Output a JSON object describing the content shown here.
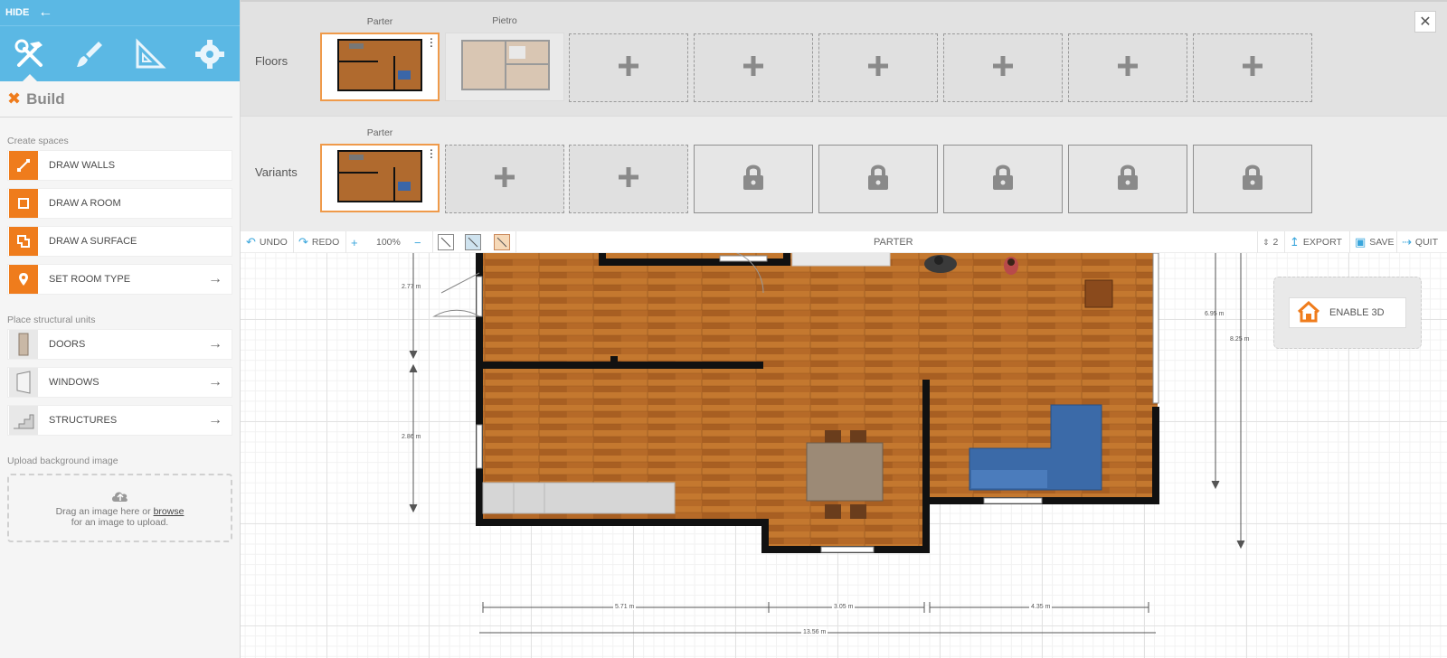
{
  "sidebar": {
    "hide_label": "HIDE",
    "panel_title": "Build",
    "create_label": "Create spaces",
    "create_items": [
      {
        "label": "DRAW WALLS"
      },
      {
        "label": "DRAW A ROOM"
      },
      {
        "label": "DRAW A SURFACE"
      },
      {
        "label": "SET ROOM TYPE"
      }
    ],
    "place_label": "Place structural units",
    "place_items": [
      {
        "label": "DOORS"
      },
      {
        "label": "WINDOWS"
      },
      {
        "label": "STRUCTURES"
      }
    ],
    "upload_label": "Upload background image",
    "upload_text1": "Drag an image here or",
    "upload_link": "browse",
    "upload_text2": "for an image to upload.",
    "accent": "#ef7c1c",
    "tab_color": "#5bb8e4"
  },
  "top_panel": {
    "floors_label": "Floors",
    "floors": [
      "Parter",
      "Pietro"
    ],
    "variants_label": "Variants",
    "variants": [
      "Parter"
    ]
  },
  "toolbar": {
    "undo": "UNDO",
    "redo": "REDO",
    "zoom": "100%",
    "floor_name": "PARTER",
    "stepper": "2",
    "export": "EXPORT",
    "save": "SAVE",
    "quit": "QUIT"
  },
  "canvas": {
    "enable3d": "ENABLE 3D",
    "dims": {
      "left_top": "2.77 m",
      "left_mid": "2.86 m",
      "right_a": "6.95 m",
      "right_b": "8.25 m",
      "bottom_a": "5.71 m",
      "bottom_b": "3.05 m",
      "bottom_c": "4.35 m",
      "bottom_total": "13.56 m"
    }
  }
}
